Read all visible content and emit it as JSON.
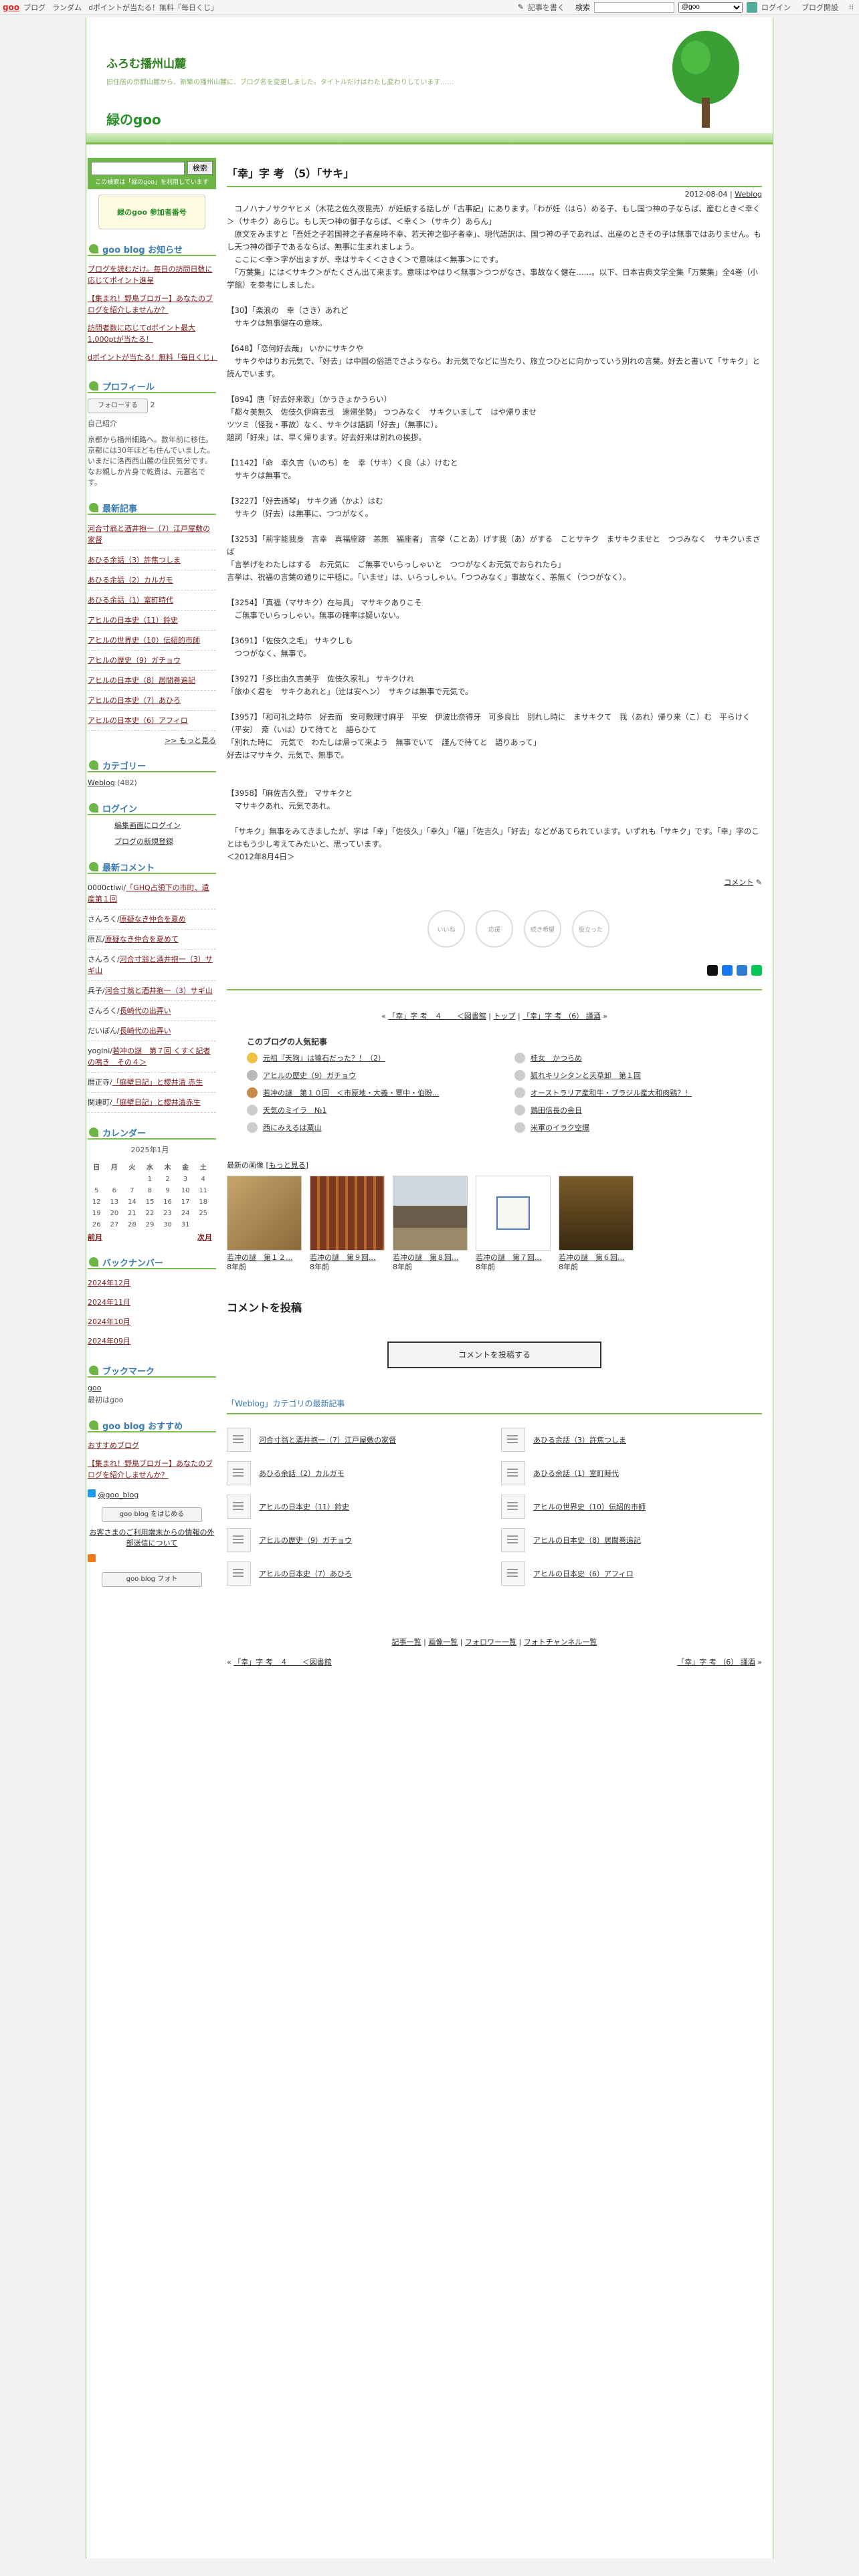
{
  "topbar": {
    "logo": "goo",
    "links": [
      "ブログ",
      "ランダム",
      "dポイントが当たる！無料「毎日くじ」"
    ],
    "write": "記事を書く",
    "search_label": "検索",
    "select": "@goo",
    "login": "ログイン",
    "blog_start": "ブログ開設"
  },
  "header": {
    "title": "ふろむ播州山麓",
    "desc": "旧住居の京都山麓から、新築の播州山麓に、ブログ名を変更しました。タイトルだけはわたし変わりしています……",
    "logo": "緑のgoo"
  },
  "side": {
    "search_btn": "検索",
    "search_note": "この検索は「緑のgoo」を利用しています",
    "badge": "緑のgoo 参加者番号",
    "h_notice": "goo blog お知らせ",
    "notices": [
      "ブログを読むだけ。毎日の訪問日数に応じてポイント進呈",
      "【集まれ！野鳥ブロガー】あなたのブログを紹介しませんか？",
      "訪問者数に応じてdポイント最大1,000ptが当たる！",
      "dポイントが当たる！無料「毎日くじ」"
    ],
    "h_profile": "プロフィール",
    "follow": "フォローする",
    "follow_count": "2",
    "profile_label": "自己紹介",
    "profile": "京都から播州細路へ。数年前に移住。京都には30年ほども住んでいました。いまだに洛西西山麓の住民気分です。なお親しか片身で乾貴は、元塞名です。",
    "h_recent": "最新記事",
    "recent": [
      "河合寸翁と酒井抱一（7）江戸屋敷の家督",
      "あひる余話（3）許焦つしま",
      "あひる余話（2）カルガモ",
      "あひる余話（1）室町時代",
      "アヒルの日本史（11）鈴史",
      "アヒルの世界史（10）伝紹的市師",
      "アヒルの歴史（9）ガチョウ",
      "アヒルの日本史（8）居間巻追記",
      "アヒルの日本史（7）あひろ",
      "アヒルの日本史（6）アフィロ"
    ],
    "more": ">> もっと見る",
    "h_category": "カテゴリー",
    "category": "Weblog",
    "category_count": "(482)",
    "h_login": "ログイン",
    "login_link": "編集画面にログイン",
    "register": "ブログの新規登録",
    "h_comments": "最新コメント",
    "comments": [
      [
        "0000ctlwi",
        "「GHQ占領下の市町、遺産第１回"
      ],
      [
        "さんろく",
        "原疑なき仲合を夏め"
      ],
      [
        "原瓦",
        "原疑なき仲合を夏めて"
      ],
      [
        "さんろく",
        "河合寸翁と酒井抱一（3）サギ山"
      ],
      [
        "兵子",
        "河合寸翁と酒井抱一（3）サギ山"
      ],
      [
        "さんろく",
        "長崎代の出弄い"
      ],
      [
        "だいぼん",
        "長崎代の出弄い"
      ],
      [
        "yogini",
        "若冲の謎　第７回 くすく記者の鳴き　その４＞"
      ],
      [
        "暦正寺",
        "「庭壁日記」と櫻井清 赤生"
      ],
      [
        "関連町",
        "「庭壁日記」と櫻井清赤生"
      ]
    ],
    "h_calendar": "カレンダー",
    "cal_month": "2025年1月",
    "cal_days": [
      "日",
      "月",
      "火",
      "水",
      "木",
      "金",
      "土"
    ],
    "cal_rows": [
      [
        "",
        "",
        "",
        "1",
        "2",
        "3",
        "4"
      ],
      [
        "5",
        "6",
        "7",
        "8",
        "9",
        "10",
        "11"
      ],
      [
        "12",
        "13",
        "14",
        "15",
        "16",
        "17",
        "18"
      ],
      [
        "19",
        "20",
        "21",
        "22",
        "23",
        "24",
        "25"
      ],
      [
        "26",
        "27",
        "28",
        "29",
        "30",
        "31",
        ""
      ]
    ],
    "cal_prev": "前月",
    "cal_next": "次月",
    "h_backnumber": "バックナンバー",
    "backnumbers": [
      "2024年12月",
      "2024年11月",
      "2024年10月",
      "2024年09月"
    ],
    "h_bookmark": "ブックマーク",
    "bookmark": "goo",
    "bookmark_sub": "最初はgoo",
    "h_recommend": "goo blog おすすめ",
    "recommend": [
      "おすすめブログ",
      "【集まれ！野鳥ブロガー】あなたのブログを紹介しませんか？"
    ],
    "twitter": "@goo_blog",
    "start_btn": "goo blog をはじめる",
    "ext_link": "お客さまのご利用端末からの情報の外部送信について",
    "photo_btn": "goo blog フォト"
  },
  "main": {
    "title": "「幸」字 考 （5）「サキ」",
    "date": "2012-08-04",
    "cat": "Weblog",
    "body": "　コノハナノサクヤヒメ（木花之佐久夜毘売）が妊娠する話しが「古事記」にあります。「わが妊（はら）める子、もし国つ神の子ならば、産むとき＜幸く＞（サキク）あらじ。もし天つ神の御子ならば、＜幸く＞（サキク）あらん」\n　原文をみますと「吾妊之子若国神之子者産時不幸、若天神之御子者幸」、現代語訳は、国つ神の子であれば、出産のときその子は無事ではありません。もし天つ神の御子であるならば、無事に生まれましょう。\n　ここに＜幸＞字が出ますが、幸はサキく＜さきく＞で意味は＜無事＞にです。\n　「万葉集」には＜サキク＞がたくさん出て来ます。意味はやはり＜無事＞つつがなさ、事故なく健在……。以下、日本古典文学全集「万葉集」全4巻（小学館）を参考にしました。\n\n【30】「楽浪の　幸（さき）あれど\n　サキクは無事健在の意味。\n\n【648】「恋何好去哉」 いかにサキクや\n　サキクやはりお元気で、「好去」は中国の俗語でさようなら。お元気でなどに当たり、旅立つひとに向かっていう別れの言葉。好去と書いて「サキク」と読んでいます。\n\n【894】唐「好去好来歌」（かうきょかうらい）\n「都々美無久　佐伎久伊麻志弖　速帰坐勢」 つつみなく　サキクいまして　はや帰りませ\nツツミ（怪我・事故）なく、サキクは語調「好去」（無事に）。\n題詞「好来」は、早く帰ります。好去好来は別れの挨拶。\n\n【1142】「命　幸久吉（いのち）を　幸（サキ）く良（よ）けむと\n　サキクは無事で。\n\n【3227】「好去通琴」 サキク通（かよ）はむ\n　サキク（好去）は無事に、つつがなく。\n\n【3253】「荊宇能我身　言幸　真福座跡　恙無　福座者」 言挙（ことあ）げす我（あ）がする　ことサキク　まサキクませと　つつみなく　サキクいまさば\n「言挙げをわたしはする　お元気に　ご無事でいらっしゃいと　つつがなくお元気でおられたら」\n言挙は、祝福の言葉の通りに平穏に。「いませ」は、いらっしゃい。「つつみなく」事故なく、恙無く（つつがなく）。\n\n【3254】「真福（マサキク）在与具」 マサキクありこそ\n　ご無事でいらっしゃい。無事の確率は疑いない。\n\n【3691】「佐伎久之毛」 サキクしも\n　つつがなく、無事で。\n\n【3927】「多比由久吉美乎　佐伎久家礼」 サキクけれ\n「旅ゆく君を　サキクあれと」（辻は安ヘン）　サキクは無事で元気で。\n\n【3957】「和可礼之時尓　好去而　安可敷理寸麻乎　平安　伊波比奈得牙　可多良比　別れし時に　まサキクて　我（あれ）帰り来（こ）む　平らけく（平安）　斎（いは）ひて待てと　語らひて\n「別れた時に　元気で　わたしは帰って来よう　無事でいて　謹んで待てと　語りあって」\n好去はマサキク、元気で、無事で。\n\n\n【3958】「麻佐吉久登」 マサキクと\n　マサキクあれ、元気であれ。\n\n　「サキク」無事をみてきましたが、字は「幸」「佐伎久」「幸久」「福」「佐吉久」「好去」などがあてられています。いずれも「サキク」です。「幸」字のことはもう少し考えてみたいと、思っています。\n＜2012年8月4日＞",
    "comment_link": "コメント",
    "reactions": [
      "いいね",
      "応援",
      "続き希望",
      "役立った"
    ],
    "prev": "「幸」字 考　４　　＜図書館",
    "top": "トップ",
    "next": "「幸」字 考 （6） 謹酒",
    "pop_title": "このブログの人気記事",
    "popular": [
      "元祖『天狗』は猿石だった？！（2）",
      "アヒルの歴史（9）ガチョウ",
      "若冲の謎　第１０回　＜市原地・大義・覃中・伯盼...",
      "天気のミイラ　№1",
      "西にみえるは粟山",
      "桂女　かつらめ",
      "狐れキリシタンと天草卸　第１回",
      "オーストラリア産和牛・ブラジル産大和肉鶏？！",
      "鶏田信長の舎日",
      "米軍のイラク空爆"
    ],
    "recent_images": "最新の画像",
    "more_images": "もっと見る",
    "thumbs": [
      [
        "若冲の謎　第１２...",
        "8年前"
      ],
      [
        "若冲の謎　第９回...",
        "8年前"
      ],
      [
        "若冲の謎　第８回...",
        "8年前"
      ],
      [
        "若冲の謎　第７回...",
        "8年前"
      ],
      [
        "若冲の謎　第６回...",
        "8年前"
      ]
    ],
    "post_comment": "コメントを投稿",
    "post_btn": "コメントを投稿する",
    "cat_latest": "「Weblog」カテゴリの最新記事",
    "cat_items": [
      "河合寸翁と酒井抱一（7）江戸屋敷の家督",
      "あひる余話（3）許焦つしま",
      "あひる余話（2）カルガモ",
      "あひる余話（1）室町時代",
      "アヒルの日本史（11）鈴史",
      "アヒルの世界史（10）伝紹的市師",
      "アヒルの歴史（9）ガチョウ",
      "アヒルの日本史（8）居間巻追記",
      "アヒルの日本史（7）あひろ",
      "アヒルの日本史（6）アフィロ"
    ],
    "footnav": [
      "記事一覧",
      "画像一覧",
      "フォロワー一覧",
      "フォトチャンネル一覧"
    ],
    "foot_prev": "「幸」字 考　４　　＜図書館",
    "foot_next": "「幸」字 考 （6） 謹酒"
  },
  "colors": {
    "accent": "#7cbf4a",
    "heading": "#3a7ab0",
    "link_dark": "#7b1b1b"
  }
}
